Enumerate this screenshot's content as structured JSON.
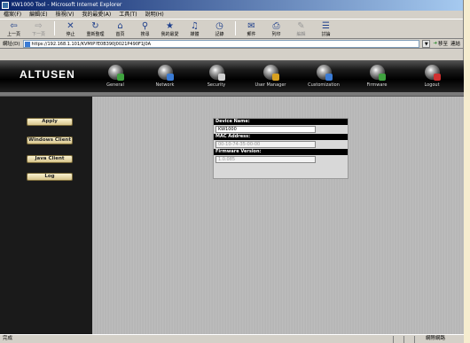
{
  "window": {
    "title": "KW1000 Tool - Microsoft Internet Explorer"
  },
  "menu": [
    "檔案(F)",
    "編輯(E)",
    "檢視(V)",
    "我的最愛(A)",
    "工具(T)",
    "說明(H)"
  ],
  "toolbar": [
    {
      "label": "上一頁",
      "glyph": "⇦",
      "enabled": true
    },
    {
      "label": "下一頁",
      "glyph": "⇨",
      "enabled": false
    },
    {
      "label": "停止",
      "glyph": "✕",
      "enabled": true
    },
    {
      "label": "重新整理",
      "glyph": "↻",
      "enabled": true
    },
    {
      "label": "首頁",
      "glyph": "⌂",
      "enabled": true
    },
    {
      "label": "搜尋",
      "glyph": "⚲",
      "enabled": true
    },
    {
      "label": "我的最愛",
      "glyph": "★",
      "enabled": true
    },
    {
      "label": "媒體",
      "glyph": "♫",
      "enabled": true
    },
    {
      "label": "記錄",
      "glyph": "◷",
      "enabled": true
    },
    {
      "label": "郵件",
      "glyph": "✉",
      "enabled": true
    },
    {
      "label": "列印",
      "glyph": "⎙",
      "enabled": true
    },
    {
      "label": "編輯",
      "glyph": "✎",
      "enabled": false
    },
    {
      "label": "討論",
      "glyph": "☰",
      "enabled": true
    }
  ],
  "address": {
    "label": "網址(D)",
    "url": "https://192.168.1.101/KVMIP?E0B390J0021P490F1J0A",
    "go_label": "移至",
    "links_label": "連結"
  },
  "app": {
    "logo": "ALTUSEN",
    "nav": [
      {
        "label": "General",
        "accent": "#3fa33f"
      },
      {
        "label": "Network",
        "accent": "#3a7bd5"
      },
      {
        "label": "Security",
        "accent": "#d0d0d0"
      },
      {
        "label": "User Manager",
        "accent": "#d8a020"
      },
      {
        "label": "Customization",
        "accent": "#3a7bd5"
      },
      {
        "label": "Firmware",
        "accent": "#3fa33f"
      },
      {
        "label": "Logout",
        "accent": "#d03030"
      }
    ],
    "sidebar": [
      "Apply",
      "Windows Client",
      "Java Client",
      "Log"
    ],
    "info": {
      "device_name_label": "Device Name:",
      "device_name": "KW1000",
      "mac_label": "MAC Address:",
      "mac": "00-10-74-35-00-00",
      "firmware_label": "Firmware Version:",
      "firmware": "1.0.085"
    }
  },
  "status": {
    "text": "完成",
    "zone": "網際網路"
  }
}
